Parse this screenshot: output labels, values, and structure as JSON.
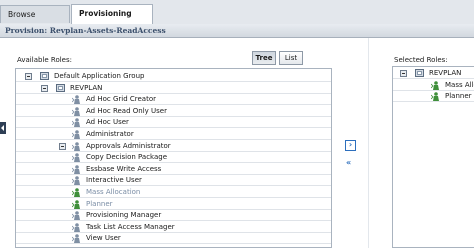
{
  "tabs": [
    {
      "label": "Browse",
      "active": false
    },
    {
      "label": "Provisioning",
      "active": true,
      "close": "x"
    }
  ],
  "header": {
    "title": "Provision: Revplan-Assets-ReadAccess"
  },
  "available": {
    "label": "Available Roles:",
    "view_buttons": {
      "tree": "Tree",
      "list": "List",
      "selected": "Tree"
    },
    "tree": [
      {
        "label": "Default Application Group",
        "level": 0,
        "icon": "folder-icon",
        "expander": true
      },
      {
        "label": "REVPLAN",
        "level": 1,
        "icon": "folder-icon",
        "expander": true
      },
      {
        "label": "Ad Hoc Grid Creator",
        "level": 2,
        "icon": "role-icon"
      },
      {
        "label": "Ad Hoc Read Only User",
        "level": 2,
        "icon": "role-icon"
      },
      {
        "label": "Ad Hoc User",
        "level": 2,
        "icon": "role-icon"
      },
      {
        "label": "Administrator",
        "level": 2,
        "icon": "role-icon"
      },
      {
        "label": "Approvals Administrator",
        "level": 2,
        "icon": "role-icon",
        "expander": true
      },
      {
        "label": "Copy Decision Package",
        "level": 2,
        "icon": "role-icon"
      },
      {
        "label": "Essbase Write Access",
        "level": 2,
        "icon": "role-icon"
      },
      {
        "label": "Interactive User",
        "level": 2,
        "icon": "role-icon"
      },
      {
        "label": "Mass Allocation",
        "level": 2,
        "icon": "role-green-icon",
        "disabled": true
      },
      {
        "label": "Planner",
        "level": 2,
        "icon": "role-green-icon",
        "disabled": true
      },
      {
        "label": "Provisioning Manager",
        "level": 2,
        "icon": "role-icon"
      },
      {
        "label": "Task List Access Manager",
        "level": 2,
        "icon": "role-icon"
      },
      {
        "label": "View User",
        "level": 2,
        "icon": "role-icon"
      }
    ]
  },
  "selected": {
    "label": "Selected Roles:",
    "tree": [
      {
        "label": "REVPLAN",
        "level": 0,
        "icon": "folder-icon",
        "expander": true
      },
      {
        "label": "Mass Allo",
        "level": 1,
        "icon": "role-green-icon"
      },
      {
        "label": "Planner",
        "level": 1,
        "icon": "role-green-icon"
      }
    ]
  },
  "actions": {
    "add": "›",
    "remove": "«"
  },
  "colors": {
    "accent": "#2d6fbd",
    "role_icon": "#7f8fa3",
    "role_green_icon": "#3f8f3a"
  }
}
